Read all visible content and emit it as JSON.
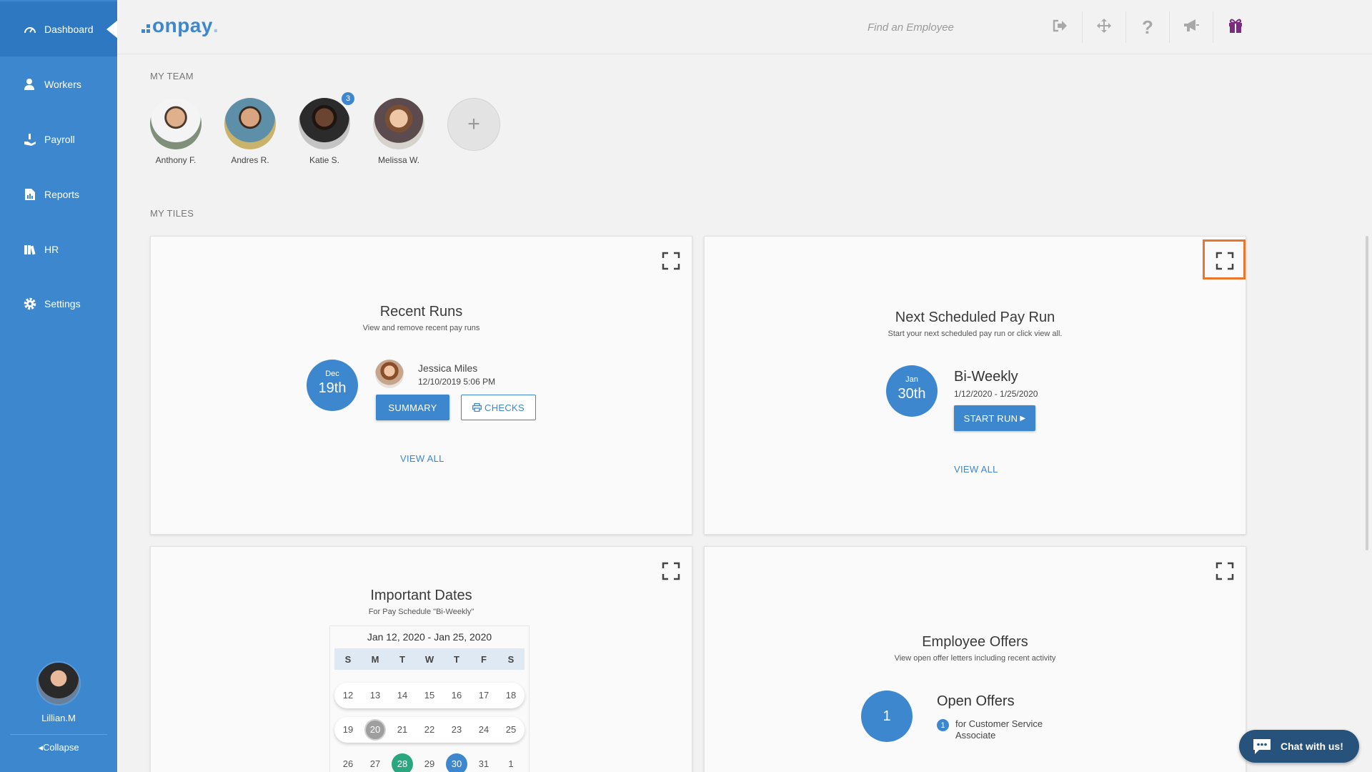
{
  "sidebar": {
    "items": [
      {
        "label": "Dashboard",
        "icon": "gauge-icon",
        "active": true
      },
      {
        "label": "Workers",
        "icon": "person-icon"
      },
      {
        "label": "Payroll",
        "icon": "hand-money-icon"
      },
      {
        "label": "Reports",
        "icon": "report-icon"
      },
      {
        "label": "HR",
        "icon": "books-icon"
      },
      {
        "label": "Settings",
        "icon": "gear-icon"
      }
    ],
    "user_name": "Lillian.M",
    "collapse_label": "Collapse"
  },
  "header": {
    "logo_text": "onpay",
    "logo_suffix": ".",
    "search_placeholder": "Find an Employee",
    "icons": [
      "logout-icon",
      "move-icon",
      "help-icon",
      "megaphone-icon",
      "gift-icon"
    ]
  },
  "team": {
    "label": "MY TEAM",
    "members": [
      {
        "name": "Anthony F."
      },
      {
        "name": "Andres R."
      },
      {
        "name": "Katie S.",
        "badge": "3"
      },
      {
        "name": "Melissa W."
      }
    ],
    "add_label": "+"
  },
  "tiles_label": "MY TILES",
  "recent_runs": {
    "title": "Recent Runs",
    "subtitle": "View and remove recent pay runs",
    "date_month": "Dec",
    "date_day": "19th",
    "person": "Jessica Miles",
    "timestamp": "12/10/2019 5:06 PM",
    "summary_label": "SUMMARY",
    "checks_label": "CHECKS",
    "view_all": "VIEW ALL"
  },
  "next_run": {
    "title": "Next Scheduled Pay Run",
    "subtitle": "Start your next scheduled pay run or click view all.",
    "date_month": "Jan",
    "date_day": "30th",
    "schedule": "Bi-Weekly",
    "range": "1/12/2020 - 1/25/2020",
    "start_label": "START RUN",
    "view_all": "VIEW ALL"
  },
  "important_dates": {
    "title": "Important Dates",
    "subtitle": "For Pay Schedule \"Bi-Weekly\"",
    "calendar_title": "Jan 12, 2020 - Jan 25, 2020",
    "weekdays": [
      "S",
      "M",
      "T",
      "W",
      "T",
      "F",
      "S"
    ],
    "weeks": [
      [
        "12",
        "13",
        "14",
        "15",
        "16",
        "17",
        "18"
      ],
      [
        "19",
        "20",
        "21",
        "22",
        "23",
        "24",
        "25"
      ],
      [
        "26",
        "27",
        "28",
        "29",
        "30",
        "31",
        "1"
      ]
    ]
  },
  "offers": {
    "title": "Employee Offers",
    "subtitle": "View open offer letters including recent activity",
    "count": "1",
    "heading": "Open Offers",
    "item_count": "1",
    "item_text_1": "for Customer Service",
    "item_text_2": "Associate"
  },
  "chat_label": "Chat with us!",
  "colors": {
    "sidebar": "#3d87cf",
    "accent": "#3d87cf",
    "highlight": "#e8772e",
    "green": "#2aa77f",
    "chat": "#27527c"
  }
}
